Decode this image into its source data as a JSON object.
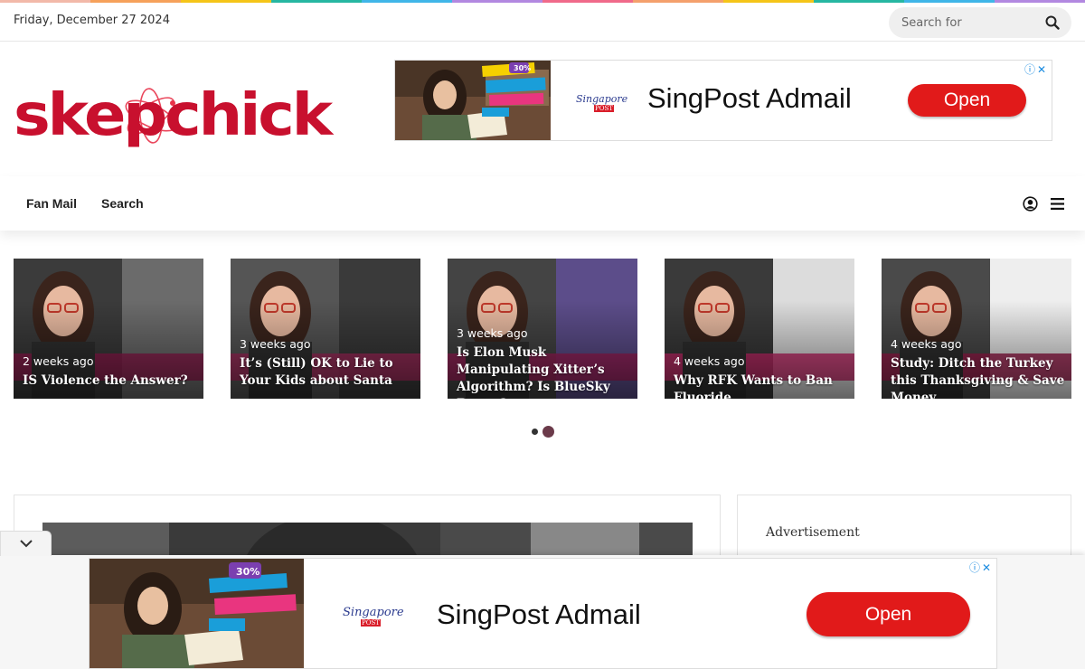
{
  "colors": {
    "rainbow": [
      "#f2b9a9",
      "#f6a15b",
      "#f5c518",
      "#26b7a2",
      "#40b6e8",
      "#b288e0",
      "#f06a8a",
      "#f4a06d",
      "#f5c518",
      "#26b7a2",
      "#40b6e8",
      "#b288e0"
    ],
    "brand_red": "#c8102e",
    "ad_button": "#e11a1a"
  },
  "topbar": {
    "date": "Friday, December 27 2024",
    "search_placeholder": "Search for",
    "search_icon": "search-icon"
  },
  "logo": {
    "text": "skepchick"
  },
  "ad_top": {
    "brand": "Singapore",
    "brand_sub": "POST",
    "title": "SingPost Admail",
    "button": "Open",
    "info_icons": "ⓘ✕"
  },
  "nav": {
    "items": [
      {
        "label": "Fan Mail"
      },
      {
        "label": "Search"
      }
    ],
    "user_icon": "user-circle-icon",
    "menu_icon": "hamburger-menu-icon"
  },
  "slider": {
    "cards": [
      {
        "time": "2 weeks ago",
        "title": "IS Violence the Answer?"
      },
      {
        "time": "3 weeks ago",
        "title": "It’s (Still) OK to Lie to Your Kids about Santa"
      },
      {
        "time": "3 weeks ago",
        "title": "Is Elon Musk Manipulating Xitter’s Algorithm? Is BlueSky Better?"
      },
      {
        "time": "4 weeks ago",
        "title": "Why RFK Wants to Ban Fluoride"
      },
      {
        "time": "4 weeks ago",
        "title": "Study: Ditch the Turkey this Thanksgiving & Save Money"
      }
    ],
    "page_count": 2,
    "active_page": 2
  },
  "sidebar": {
    "advertisement_label": "Advertisement"
  },
  "ad_bottom": {
    "brand": "Singapore",
    "brand_sub": "POST",
    "title": "SingPost Admail",
    "button": "Open",
    "info_icons": "ⓘ✕"
  }
}
